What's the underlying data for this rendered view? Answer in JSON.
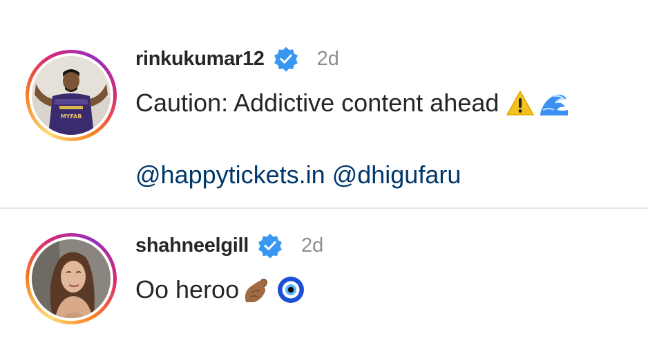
{
  "comments": [
    {
      "username": "rinkukumar12",
      "time": "2d",
      "text": "Caution: Addictive content ahead",
      "emojis": [
        "warning-emoji",
        "wave-emoji"
      ],
      "mentions": [
        "@happytickets.in",
        "@dhigufaru"
      ],
      "verified": true
    },
    {
      "username": "shahneelgill",
      "time": "2d",
      "text": "Oo heroo",
      "emojis": [
        "pinched-fingers-emoji",
        "nazar-amulet-emoji"
      ],
      "verified": true
    }
  ],
  "colors": {
    "verified_blue": "#3897f0",
    "mention_blue": "#00376b",
    "timestamp_gray": "#8e8e8e",
    "divider": "#e6e6e6"
  }
}
